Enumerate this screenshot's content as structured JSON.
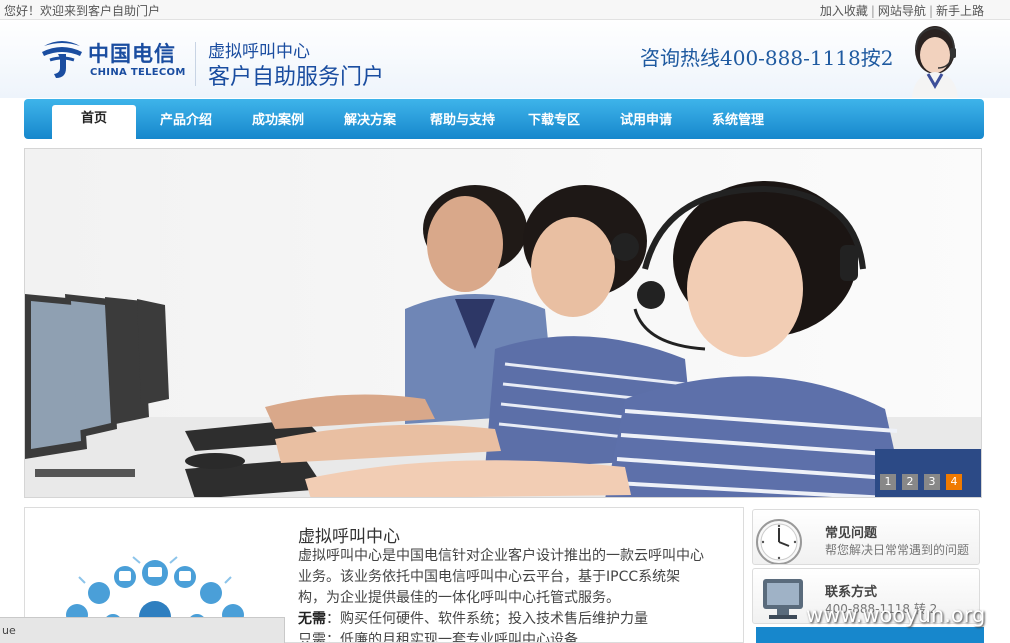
{
  "topbar": {
    "welcome": "您好！欢迎来到客户自助门户",
    "links": [
      "加入收藏",
      "网站导航",
      "新手上路"
    ],
    "separator": "|"
  },
  "header": {
    "logo_cn": "中国电信",
    "logo_en": "CHINA TELECOM",
    "portal_sub": "虚拟呼叫中心",
    "portal_title": "客户自助服务门户",
    "hotline": "咨询热线400-888-1118按2"
  },
  "nav": {
    "items": [
      {
        "label": "首页",
        "active": true
      },
      {
        "label": "产品介绍"
      },
      {
        "label": "成功案例"
      },
      {
        "label": "解决方案"
      },
      {
        "label": "帮助与支持"
      },
      {
        "label": "下载专区"
      },
      {
        "label": "试用申请"
      },
      {
        "label": "系统管理"
      }
    ]
  },
  "banner": {
    "pages": [
      "1",
      "2",
      "3",
      "4"
    ],
    "active_page": "4"
  },
  "intro": {
    "title": "虚拟呼叫中心",
    "para1": "虚拟呼叫中心是中国电信针对企业客户设计推出的一款云呼叫中心业务。该业务依托中国电信呼叫中心云平台，基于IPCC系统架构，为企业提供最佳的一体化呼叫中心托管式服务。",
    "para2_label": "无需",
    "para2_colon": "：",
    "para2": "购买任何硬件、软件系统；投入技术售后维护力量",
    "para3": "只需：低廉的月租实现一套专业呼叫中心设备"
  },
  "sidebar": {
    "faq": {
      "title": "常见问题",
      "desc": "帮您解决日常常遇到的问题"
    },
    "contact": {
      "title": "联系方式",
      "desc": "400-888-1118 转 2"
    }
  },
  "status": {
    "text": "ue"
  },
  "watermark": "www.wooyun.org",
  "colors": {
    "nav_blue": "#1787cc",
    "brand_blue": "#1a4da0",
    "pager_active": "#f07a00"
  }
}
